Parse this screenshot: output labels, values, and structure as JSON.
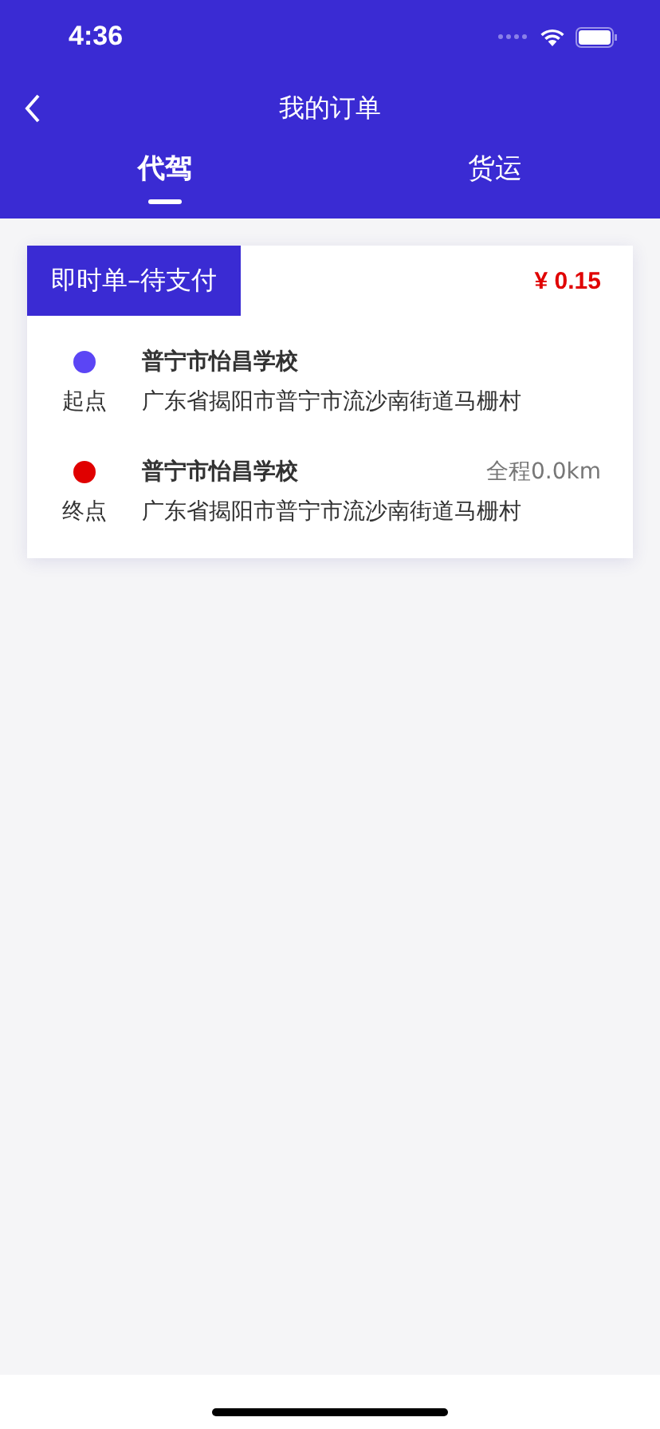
{
  "status_bar": {
    "time": "4:36"
  },
  "nav": {
    "title": "我的订单"
  },
  "tabs": [
    {
      "label": "代驾",
      "selected": true
    },
    {
      "label": "货运",
      "selected": false
    }
  ],
  "orders": [
    {
      "status": "即时单–待支付",
      "price": "¥ 0.15",
      "stops": [
        {
          "color": "#5b45f5",
          "label": "起点",
          "name": "普宁市怡昌学校",
          "address": "广东省揭阳市普宁市流沙南街道马栅村"
        },
        {
          "color": "#e00000",
          "label": "终点",
          "name": "普宁市怡昌学校",
          "address": "广东省揭阳市普宁市流沙南街道马栅村",
          "distance": "全程0.0km"
        }
      ]
    }
  ]
}
